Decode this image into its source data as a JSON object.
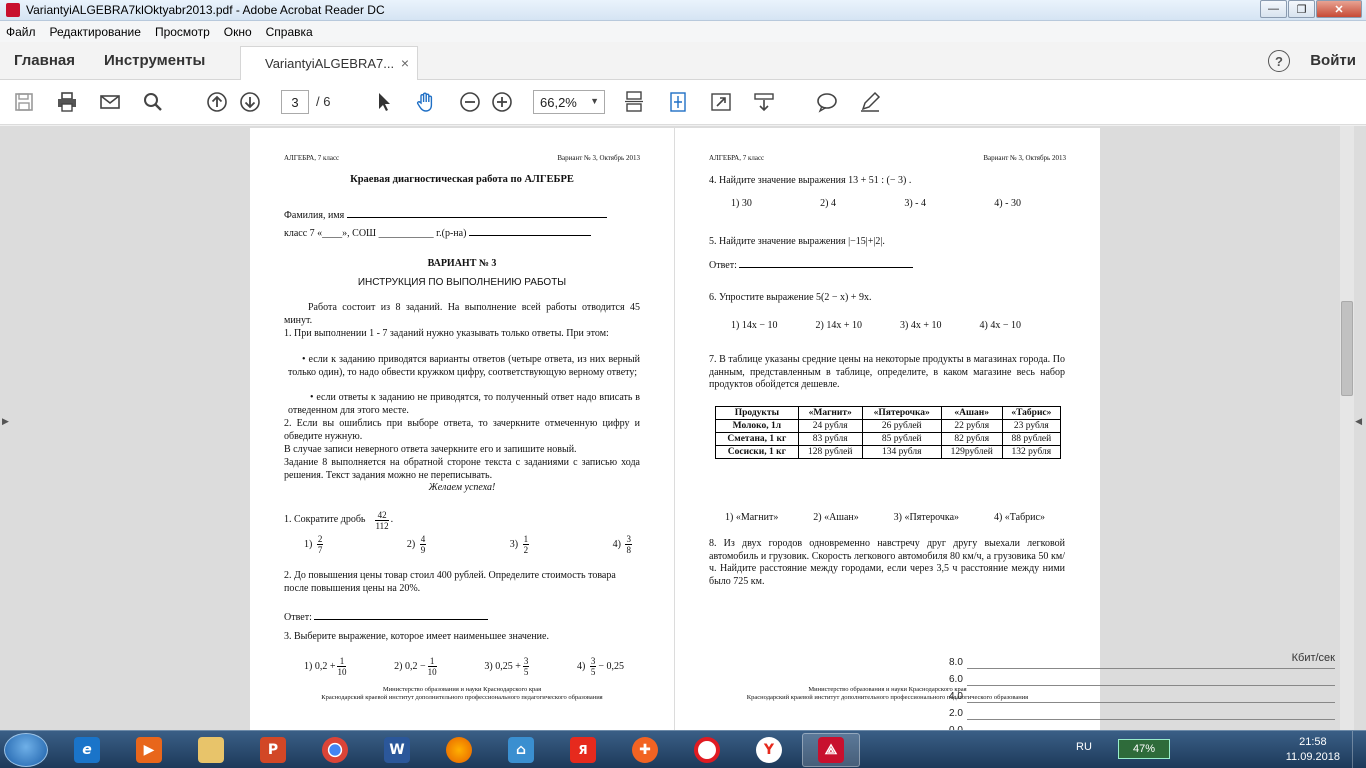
{
  "window": {
    "title": "VariantyiALGEBRA7klOktyabr2013.pdf - Adobe Acrobat Reader DC",
    "minimize": "—",
    "restore": "❐",
    "close": "✕"
  },
  "menu": [
    "Файл",
    "Редактирование",
    "Просмотр",
    "Окно",
    "Справка"
  ],
  "tabs": {
    "home": "Главная",
    "tools": "Инструменты",
    "document": "VariantyiALGEBRA7...",
    "close": "×",
    "help": "?",
    "signin": "Войти"
  },
  "toolbar": {
    "page_current": "3",
    "page_total": "/ 6",
    "zoom": "66,2%",
    "icons": [
      "save-icon",
      "print-icon",
      "email-icon",
      "search-icon",
      "prev-page-icon",
      "next-page-icon",
      "select-pointer-icon",
      "hand-tool-icon",
      "zoom-out-icon",
      "zoom-in-icon",
      "scrolling-mode-icon",
      "fit-page-icon",
      "fullscreen-icon",
      "read-mode-icon",
      "comment-icon",
      "sign-icon"
    ]
  },
  "page_left": {
    "header_left": "АЛГЕБРА, 7 класс",
    "header_right": "Вариант № 3, Октябрь 2013",
    "title": "Краевая диагностическая работа по АЛГЕБРЕ",
    "name_label": "Фамилия, имя",
    "class_label": "класс 7 «____»,  СОШ ___________  г.(р-на)",
    "variant": "ВАРИАНТ № 3",
    "instruction_title": "ИНСТРУКЦИЯ ПО ВЫПОЛНЕНИЮ РАБОТЫ",
    "intro": "Работа состоит из 8 заданий. На выполнение всей работы отводится 45 минут.",
    "rule1": "1.  При выполнении 1 - 7 заданий нужно указывать только ответы. При этом:",
    "rule1a": "• если к заданию приводятся варианты ответов (четыре ответа, из них верный только один), то надо обвести кружком цифру, соответствующую верному ответу;",
    "rule1b": "• если ответы к заданию не приводятся, то полученный ответ надо вписать в отведенном для этого месте.",
    "rule2": "2.  Если вы ошиблись при выборе ответа, то зачеркните отмеченную цифру и обведите нужную.",
    "rule3": "В случае записи неверного ответа зачеркните его и запишите новый.",
    "rule4": "Задание 8 выполняется на обратной стороне текста с заданиями с записью хода решения. Текст задания можно не переписывать.",
    "wish": "Желаем успеха!",
    "q1": "1. Сократите дробь",
    "q1_frac_num": "42",
    "q1_frac_den": "112",
    "q1_opts": [
      {
        "n": "1)",
        "num": "2",
        "den": "7"
      },
      {
        "n": "2)",
        "num": "4",
        "den": "9"
      },
      {
        "n": "3)",
        "num": "1",
        "den": "2"
      },
      {
        "n": "4)",
        "num": "3",
        "den": "8"
      }
    ],
    "q2": "2. До повышения цены товар стоил 400 рублей. Определите стоимость товара после повышения цены на 20%.",
    "q2_answer": "Ответ:",
    "q3": "3.  Выберите выражение, которое имеет наименьшее значение.",
    "q3_opts": [
      {
        "n": "1)",
        "pre": "0,2 +",
        "num": "1",
        "den": "10",
        "post": ""
      },
      {
        "n": "2)",
        "pre": "0,2 −",
        "num": "1",
        "den": "10",
        "post": ""
      },
      {
        "n": "3)",
        "pre": "0,25 +",
        "num": "3",
        "den": "5",
        "post": ""
      },
      {
        "n": "4)",
        "pre": "",
        "num": "3",
        "den": "5",
        "post": "− 0,25"
      }
    ],
    "footer1": "Министерство образования и науки Краснодарского края",
    "footer2": "Краснодарский краевой институт дополнительного профессионального педагогического образования"
  },
  "page_right": {
    "header_left": "АЛГЕБРА, 7 класс",
    "header_right": "Вариант № 3, Октябрь 2013",
    "q4": "4. Найдите значение выражения  13 + 51 : (− 3) .",
    "q4_opts": [
      "1)  30",
      "2)  4",
      "3)  - 4",
      "4)  - 30"
    ],
    "q5": "5. Найдите значение выражения   |−15|+|2|.",
    "q5_answer": "Ответ:",
    "q6": "6. Упростите выражение   5(2 − x) + 9x.",
    "q6_opts": [
      "1)  14x − 10",
      "2)  14x + 10",
      "3)  4x + 10",
      "4)  4x − 10"
    ],
    "q7": "7.  В таблице указаны средние цены на некоторые продукты в магазинах города. По данным, представленным в таблице, определите, в каком магазине весь набор продуктов обойдется дешевле.",
    "table": {
      "headers": [
        "Продукты",
        "«Магнит»",
        "«Пятерочка»",
        "«Ашан»",
        "«Табрис»"
      ],
      "rows": [
        [
          "Молоко, 1л",
          "24 рубля",
          "26 рублей",
          "22 рубля",
          "23 рубля"
        ],
        [
          "Сметана, 1 кг",
          "83 рубля",
          "85 рублей",
          "82 рубля",
          "88 рублей"
        ],
        [
          "Сосиски, 1 кг",
          "128 рублей",
          "134 рубля",
          "129рублей",
          "132 рубля"
        ]
      ]
    },
    "q7_opts": [
      "1)  «Магнит»",
      "2)  «Ашан»",
      "3)  «Пятерочка»",
      "4)  «Табрис»"
    ],
    "q8": "8. Из двух городов одновременно навстречу друг другу выехали легковой автомобиль и грузовик. Скорость легкового автомобиля 80 км/ч, а грузовика 50 км/ч. Найдите расстояние между городами, если через 3,5 ч расстояние между ними было 725 км.",
    "footer1": "Министерство образования и науки Краснодарского края",
    "footer2": "Краснодарский краевой институт дополнительного профессионального педагогического образования"
  },
  "network_overlay": {
    "unit": "Кбит/сек",
    "labels": [
      "8.0",
      "6.0",
      "4.0",
      "2.0",
      "0.0"
    ]
  },
  "taskbar": {
    "apps": [
      "windows-explorer",
      "ie",
      "media-player",
      "explorer-folder",
      "powerpoint",
      "chrome",
      "word",
      "firefox",
      "app-store",
      "yandex-ya",
      "app-orange",
      "opera",
      "yandex-browser",
      "acrobat"
    ],
    "lang": "RU",
    "battery": "47%",
    "time": "21:58",
    "date": "11.09.2018"
  },
  "colors": {
    "acrobat_red": "#c8102e",
    "taskbar": "#1d3a5a"
  }
}
